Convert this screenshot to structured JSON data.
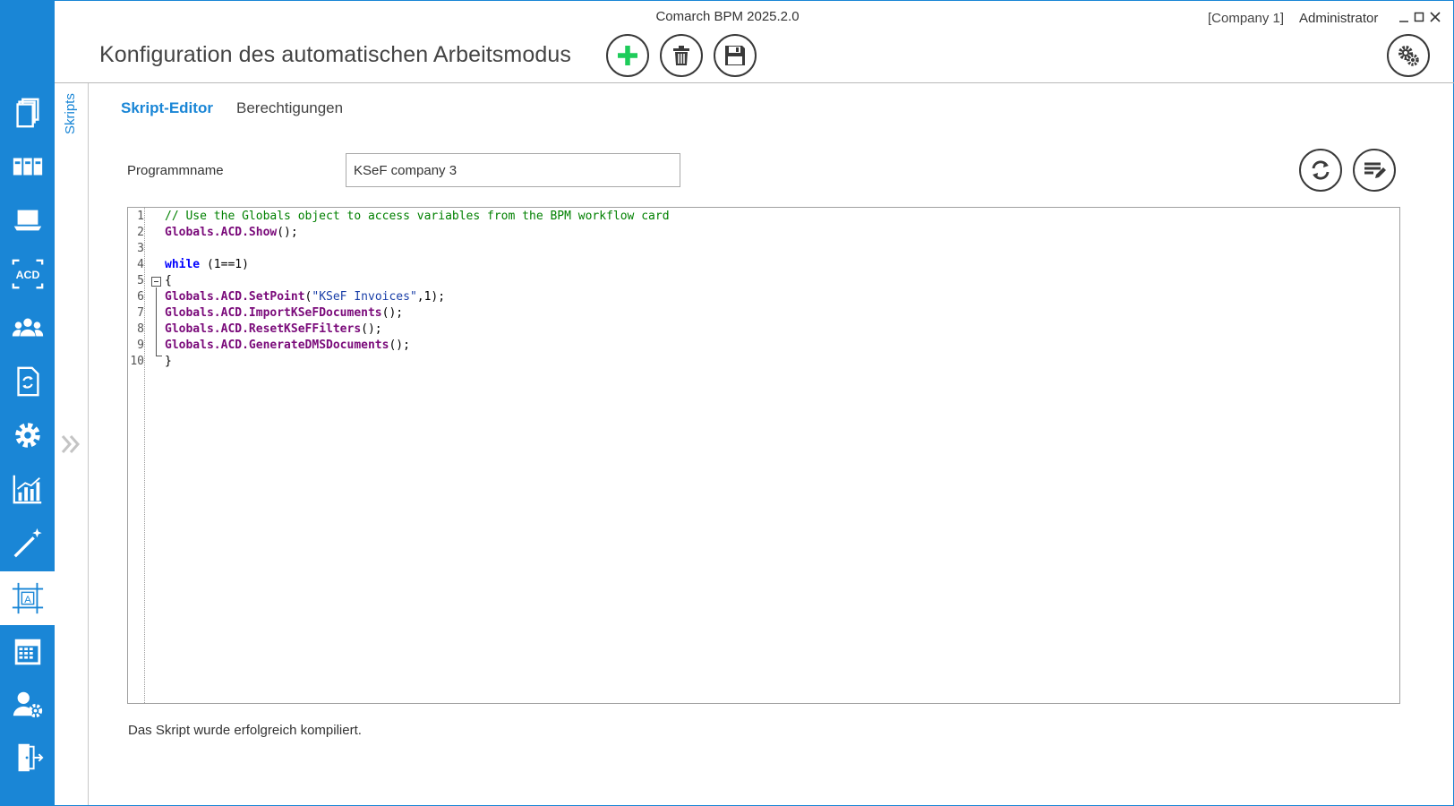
{
  "window": {
    "app_title": "Comarch BPM 2025.2.0",
    "company": "[Company 1]",
    "user": "Administrator"
  },
  "page": {
    "title": "Konfiguration des automatischen Arbeitsmodus"
  },
  "colors": {
    "accent": "#1a86d6",
    "add_green": "#1ecc5a",
    "icon_dark": "#3a3a3a"
  },
  "sidebar": {
    "items": [
      {
        "icon": "documents-icon"
      },
      {
        "icon": "binders-icon"
      },
      {
        "icon": "laptop-icon"
      },
      {
        "icon": "acd-icon",
        "text": "ACD"
      },
      {
        "icon": "users-icon"
      },
      {
        "icon": "document-sync-icon"
      },
      {
        "icon": "gear-icon"
      },
      {
        "icon": "chart-icon"
      },
      {
        "icon": "magic-wand-icon"
      },
      {
        "icon": "text-frame-icon",
        "text": "A",
        "active": true
      },
      {
        "icon": "calendar-icon"
      },
      {
        "icon": "user-settings-icon"
      },
      {
        "icon": "exit-door-icon"
      }
    ]
  },
  "vertical_tab": {
    "label": "Skripts"
  },
  "tabs": [
    {
      "label": "Skript-Editor",
      "active": true
    },
    {
      "label": "Berechtigungen",
      "active": false
    }
  ],
  "form": {
    "program_name_label": "Programmname",
    "program_name_value": "KSeF company 3"
  },
  "editor": {
    "line_numbers": [
      "1",
      "2",
      "3",
      "4",
      "5",
      "6",
      "7",
      "8",
      "9",
      "10"
    ],
    "lines": {
      "l1_comment": "// Use the Globals object to access variables from the BPM workflow card",
      "l2_obj": "Globals.ACD.",
      "l2_method": "Show",
      "l2_rest": "();",
      "l4_kw": "while",
      "l4_rest": " (1==1)",
      "l5": "{",
      "l6_obj": "Globals.ACD.",
      "l6_method": "SetPoint",
      "l6_open": "(",
      "l6_str": "\"KSeF Invoices\"",
      "l6_rest": ",1);",
      "l7_obj": "Globals.ACD.",
      "l7_method": "ImportKSeFDocuments",
      "l7_rest": "();",
      "l8_obj": "Globals.ACD.",
      "l8_method": "ResetKSeFFilters",
      "l8_rest": "();",
      "l9_obj": "Globals.ACD.",
      "l9_method": "GenerateDMSDocuments",
      "l9_rest": "();",
      "l10": "}"
    }
  },
  "status": {
    "message": "Das Skript wurde erfolgreich kompiliert."
  }
}
